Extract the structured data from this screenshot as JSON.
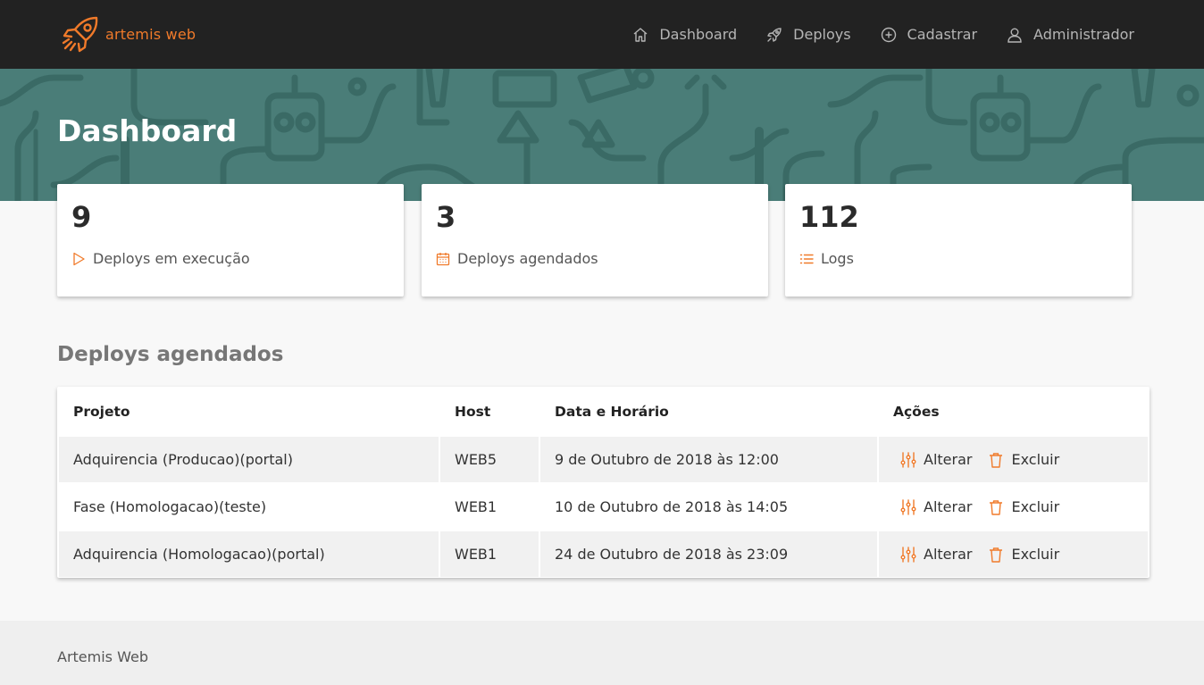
{
  "brand": {
    "name": "artemis web",
    "icon": "rocket-icon",
    "color": "#f07a2a"
  },
  "nav": {
    "items": [
      {
        "label": "Dashboard",
        "icon": "home-icon"
      },
      {
        "label": "Deploys",
        "icon": "rocket-icon"
      },
      {
        "label": "Cadastrar",
        "icon": "plus-circle-icon"
      },
      {
        "label": "Administrador",
        "icon": "user-icon"
      }
    ]
  },
  "hero": {
    "title": "Dashboard",
    "background": "#4a7d78"
  },
  "stats": [
    {
      "value": "9",
      "label": "Deploys em execução",
      "icon": "play-icon"
    },
    {
      "value": "3",
      "label": "Deploys agendados",
      "icon": "calendar-icon"
    },
    {
      "value": "112",
      "label": "Logs",
      "icon": "list-icon"
    }
  ],
  "scheduled": {
    "title": "Deploys agendados",
    "columns": [
      "Projeto",
      "Host",
      "Data e Horário",
      "Ações"
    ],
    "rows": [
      {
        "project": "Adquirencia (Producao)(portal)",
        "host": "WEB5",
        "datetime": "9 de Outubro de 2018 às 12:00"
      },
      {
        "project": "Fase (Homologacao)(teste)",
        "host": "WEB1",
        "datetime": "10 de Outubro de 2018 às 14:05"
      },
      {
        "project": "Adquirencia (Homologacao)(portal)",
        "host": "WEB1",
        "datetime": "24 de Outubro de 2018 às 23:09"
      }
    ],
    "actions": {
      "edit_label": "Alterar",
      "delete_label": "Excluir"
    }
  },
  "footer": {
    "text": "Artemis Web"
  },
  "colors": {
    "accent": "#f07a2a",
    "navbar": "#222222"
  }
}
